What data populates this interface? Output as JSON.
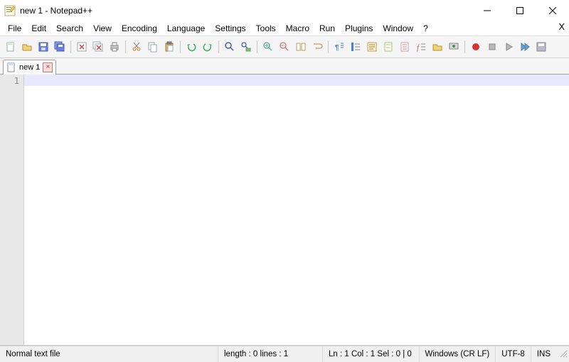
{
  "title": "new 1 - Notepad++",
  "menu": [
    "File",
    "Edit",
    "Search",
    "View",
    "Encoding",
    "Language",
    "Settings",
    "Tools",
    "Macro",
    "Run",
    "Plugins",
    "Window",
    "?"
  ],
  "tab": {
    "label": "new 1"
  },
  "gutter_line": "1",
  "status": {
    "filetype": "Normal text file",
    "length": "length : 0    lines : 1",
    "pos": "Ln : 1    Col : 1    Sel : 0 | 0",
    "eol": "Windows (CR LF)",
    "encoding": "UTF-8",
    "insmode": "INS"
  }
}
